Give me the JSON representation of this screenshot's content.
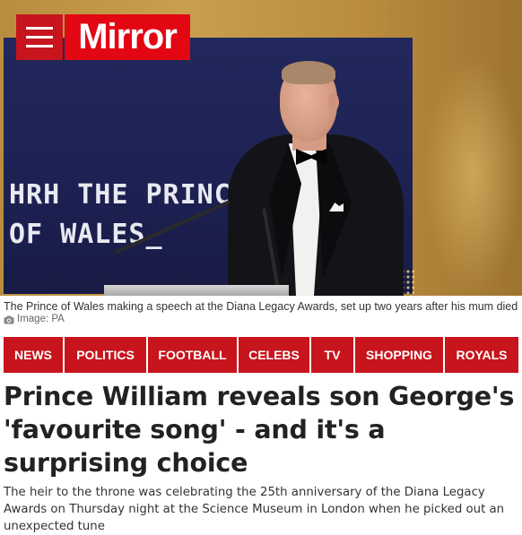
{
  "header": {
    "logo_text": "Mirror",
    "brand_color": "#e30613"
  },
  "hero": {
    "screen_text": "HRH THE PRINCE\nOF WALES_",
    "caption": "The Prince of Wales making a speech at the Diana Legacy Awards, set up two years after his mum died",
    "credit": "Image: PA"
  },
  "nav": {
    "items": [
      "NEWS",
      "POLITICS",
      "FOOTBALL",
      "CELEBS",
      "TV",
      "SHOPPING",
      "ROYALS"
    ]
  },
  "article": {
    "headline": "Prince William reveals son George's 'favourite song' - and it's a surprising choice",
    "standfirst": "The heir to the throne was celebrating the 25th anniversary of the Diana Legacy Awards on Thursday night at the Science Museum in London when he picked out an unexpected tune"
  }
}
